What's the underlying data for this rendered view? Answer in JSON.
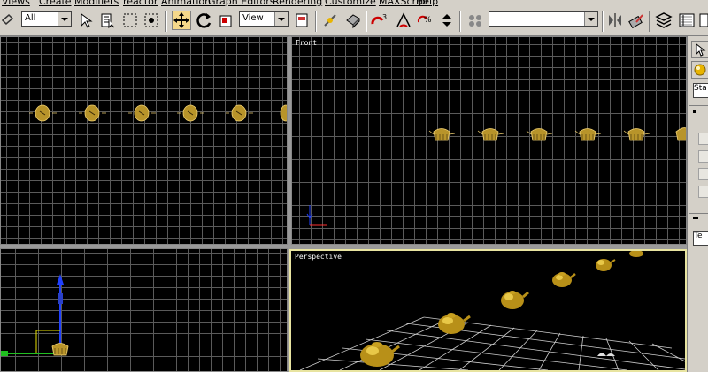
{
  "menu": [
    "Views",
    "Create",
    "Modifiers",
    "reactor",
    "Animation",
    "Graph Editors",
    "Rendering",
    "Customize",
    "MAXScript",
    "Help"
  ],
  "toolbar": {
    "selection_filter": "All",
    "reference_coord": "View",
    "named_selection": ""
  },
  "viewports": {
    "top": {
      "label": ""
    },
    "front": {
      "label": "Front"
    },
    "left": {
      "label": ""
    },
    "perspective": {
      "label": "Perspective"
    }
  },
  "command_panel": {
    "dropdown_text": "Sta",
    "field_text": "Te"
  },
  "colors": {
    "teapot": "#b8942a",
    "active_border": "#e8e4a0",
    "grid": "#5a5a5a"
  }
}
